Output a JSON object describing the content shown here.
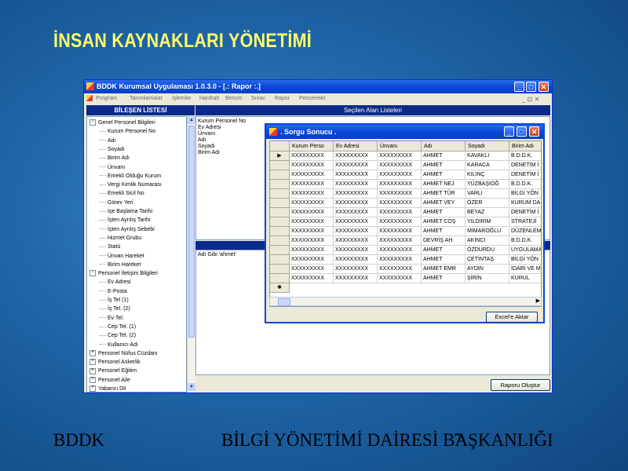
{
  "slide": {
    "title": "İNSAN KAYNAKLARI YÖNETİMİ",
    "footer_left": "BDDK",
    "footer_right": "BİLGİ YÖNETİMİ DAİRESİ BAŞKANLIĞI",
    "page_number": "7"
  },
  "app": {
    "title": "BDDK Kurumsal Uygulaması 1.0.3.0 - [.: Rapor :.]",
    "window_controls": {
      "minimize": "_",
      "maximize": "□",
      "close": "✕"
    },
    "menu": [
      "Program",
      "Tanımlamalar",
      "İşlemler",
      "Hardrah",
      "Benzin",
      "Sınav",
      "Rapor",
      "Pencereler"
    ],
    "mdi_controls": "_ ⊡ ✕",
    "left_header": "BİLEŞEN LİSTESİ",
    "right_header": "Seçilen Alan Listeleri",
    "tree": [
      {
        "label": "Genel Personel Bilgileri",
        "level": 0,
        "exp": "−"
      },
      {
        "label": "Kurum Personel No",
        "level": 1
      },
      {
        "label": "Adı",
        "level": 1
      },
      {
        "label": "Soyadı",
        "level": 1
      },
      {
        "label": "Birim Adı",
        "level": 1
      },
      {
        "label": "Ünvanı",
        "level": 1
      },
      {
        "label": "Emekli Olduğu Kurum",
        "level": 1
      },
      {
        "label": "Vergi Kimlik Numarası",
        "level": 1
      },
      {
        "label": "Emekli Sicil No",
        "level": 1
      },
      {
        "label": "Görev Yeri",
        "level": 1
      },
      {
        "label": "İşe Başlama Tarihi",
        "level": 1
      },
      {
        "label": "İşten Ayrılış Tarihi",
        "level": 1
      },
      {
        "label": "İşten Ayrılış Sebebi",
        "level": 1
      },
      {
        "label": "Hizmet Grubu",
        "level": 1
      },
      {
        "label": "Statü",
        "level": 1
      },
      {
        "label": "Ünvan Hareket",
        "level": 1
      },
      {
        "label": "Birim Hareket",
        "level": 1
      },
      {
        "label": "Personel İletişim Bilgileri",
        "level": 0,
        "exp": "−"
      },
      {
        "label": "Ev Adresi",
        "level": 1
      },
      {
        "label": "E-Posta",
        "level": 1
      },
      {
        "label": "İş Tel (1)",
        "level": 1
      },
      {
        "label": "İş Tel. (2)",
        "level": 1
      },
      {
        "label": "Ev Tel.",
        "level": 1
      },
      {
        "label": "Cep Tel. (1)",
        "level": 1
      },
      {
        "label": "Cep Tel. (2)",
        "level": 1
      },
      {
        "label": "Kullanıcı Adı",
        "level": 1
      },
      {
        "label": "Personel Nüfus Cüzdanı",
        "level": 0,
        "exp": "+"
      },
      {
        "label": "Personel Askerlik",
        "level": 0,
        "exp": "+"
      },
      {
        "label": "Personel Eğitim",
        "level": 0,
        "exp": "+"
      },
      {
        "label": "Personel Aile",
        "level": 0,
        "exp": "+"
      },
      {
        "label": "Yabancı Dil",
        "level": 0,
        "exp": "+"
      }
    ],
    "selected_fields": [
      "Kurum Personel No",
      "Ev Adresi",
      "Ünvanı",
      "Adı",
      "Soyadı",
      "Birim Adı"
    ],
    "query_text": "Adı Gibi 'ahmet'",
    "report_button": "Raporu Oluştur"
  },
  "dialog": {
    "title": ". Sorgu Sonucu .",
    "columns": [
      "Kurum Perso",
      "Ev Adresi",
      "Ünvanı",
      "Adı",
      "Soyadı",
      "Birim Adı"
    ],
    "rows": [
      [
        "XXXXXXXXX",
        "XXXXXXXXX",
        "XXXXXXXXX",
        "AHMET",
        "KAVAKLI",
        "B.D.D.K."
      ],
      [
        "XXXXXXXXX",
        "XXXXXXXXX",
        "XXXXXXXXX",
        "AHMET",
        "KARACA",
        "DENETİM İ"
      ],
      [
        "XXXXXXXXX",
        "XXXXXXXXX",
        "XXXXXXXXX",
        "AHMET",
        "KILINÇ",
        "DENETİM İ"
      ],
      [
        "XXXXXXXXX",
        "XXXXXXXXX",
        "XXXXXXXXX",
        "AHMET NEJ",
        "YÜZBAŞIOĞ",
        "B.D.D.K."
      ],
      [
        "XXXXXXXXX",
        "XXXXXXXXX",
        "XXXXXXXXX",
        "AHMET TÜR",
        "VARLI",
        "BİLGİ YÖN"
      ],
      [
        "XXXXXXXXX",
        "XXXXXXXXX",
        "XXXXXXXXX",
        "AHMET VEY",
        "ÖZER",
        "KURUM DA"
      ],
      [
        "XXXXXXXXX",
        "XXXXXXXXX",
        "XXXXXXXXX",
        "AHMET",
        "BEYAZ",
        "DENETİM İ"
      ],
      [
        "XXXXXXXXX",
        "XXXXXXXXX",
        "XXXXXXXXX",
        "AHMET COŞ",
        "YILDIRIM",
        "STRATEJİ"
      ],
      [
        "XXXXXXXXX",
        "XXXXXXXXX",
        "XXXXXXXXX",
        "AHMET",
        "MİMAROĞLU",
        "DÜZENLEM"
      ],
      [
        "XXXXXXXXX",
        "XXXXXXXXX",
        "XXXXXXXXX",
        "DEVRİŞ AH",
        "AKINCI",
        "B.D.D.K."
      ],
      [
        "XXXXXXXXX",
        "XXXXXXXXX",
        "XXXXXXXXX",
        "AHMET",
        "ÖZDURDU",
        "UYGULAMA"
      ],
      [
        "XXXXXXXXX",
        "XXXXXXXXX",
        "XXXXXXXXX",
        "AHMET",
        "ÇETİNTAŞ",
        "BİLGİ YÖN"
      ],
      [
        "XXXXXXXXX",
        "XXXXXXXXX",
        "XXXXXXXXX",
        "AHMET EMR",
        "AYDIN",
        "İDARİ VE M"
      ],
      [
        "XXXXXXXXX",
        "XXXXXXXXX",
        "XXXXXXXXX",
        "AHMET",
        "ŞİRİN",
        "KURUL"
      ]
    ],
    "current_row_marker": "▶",
    "new_row_marker": "✱",
    "excel_button": "Excel'e Aktar"
  }
}
